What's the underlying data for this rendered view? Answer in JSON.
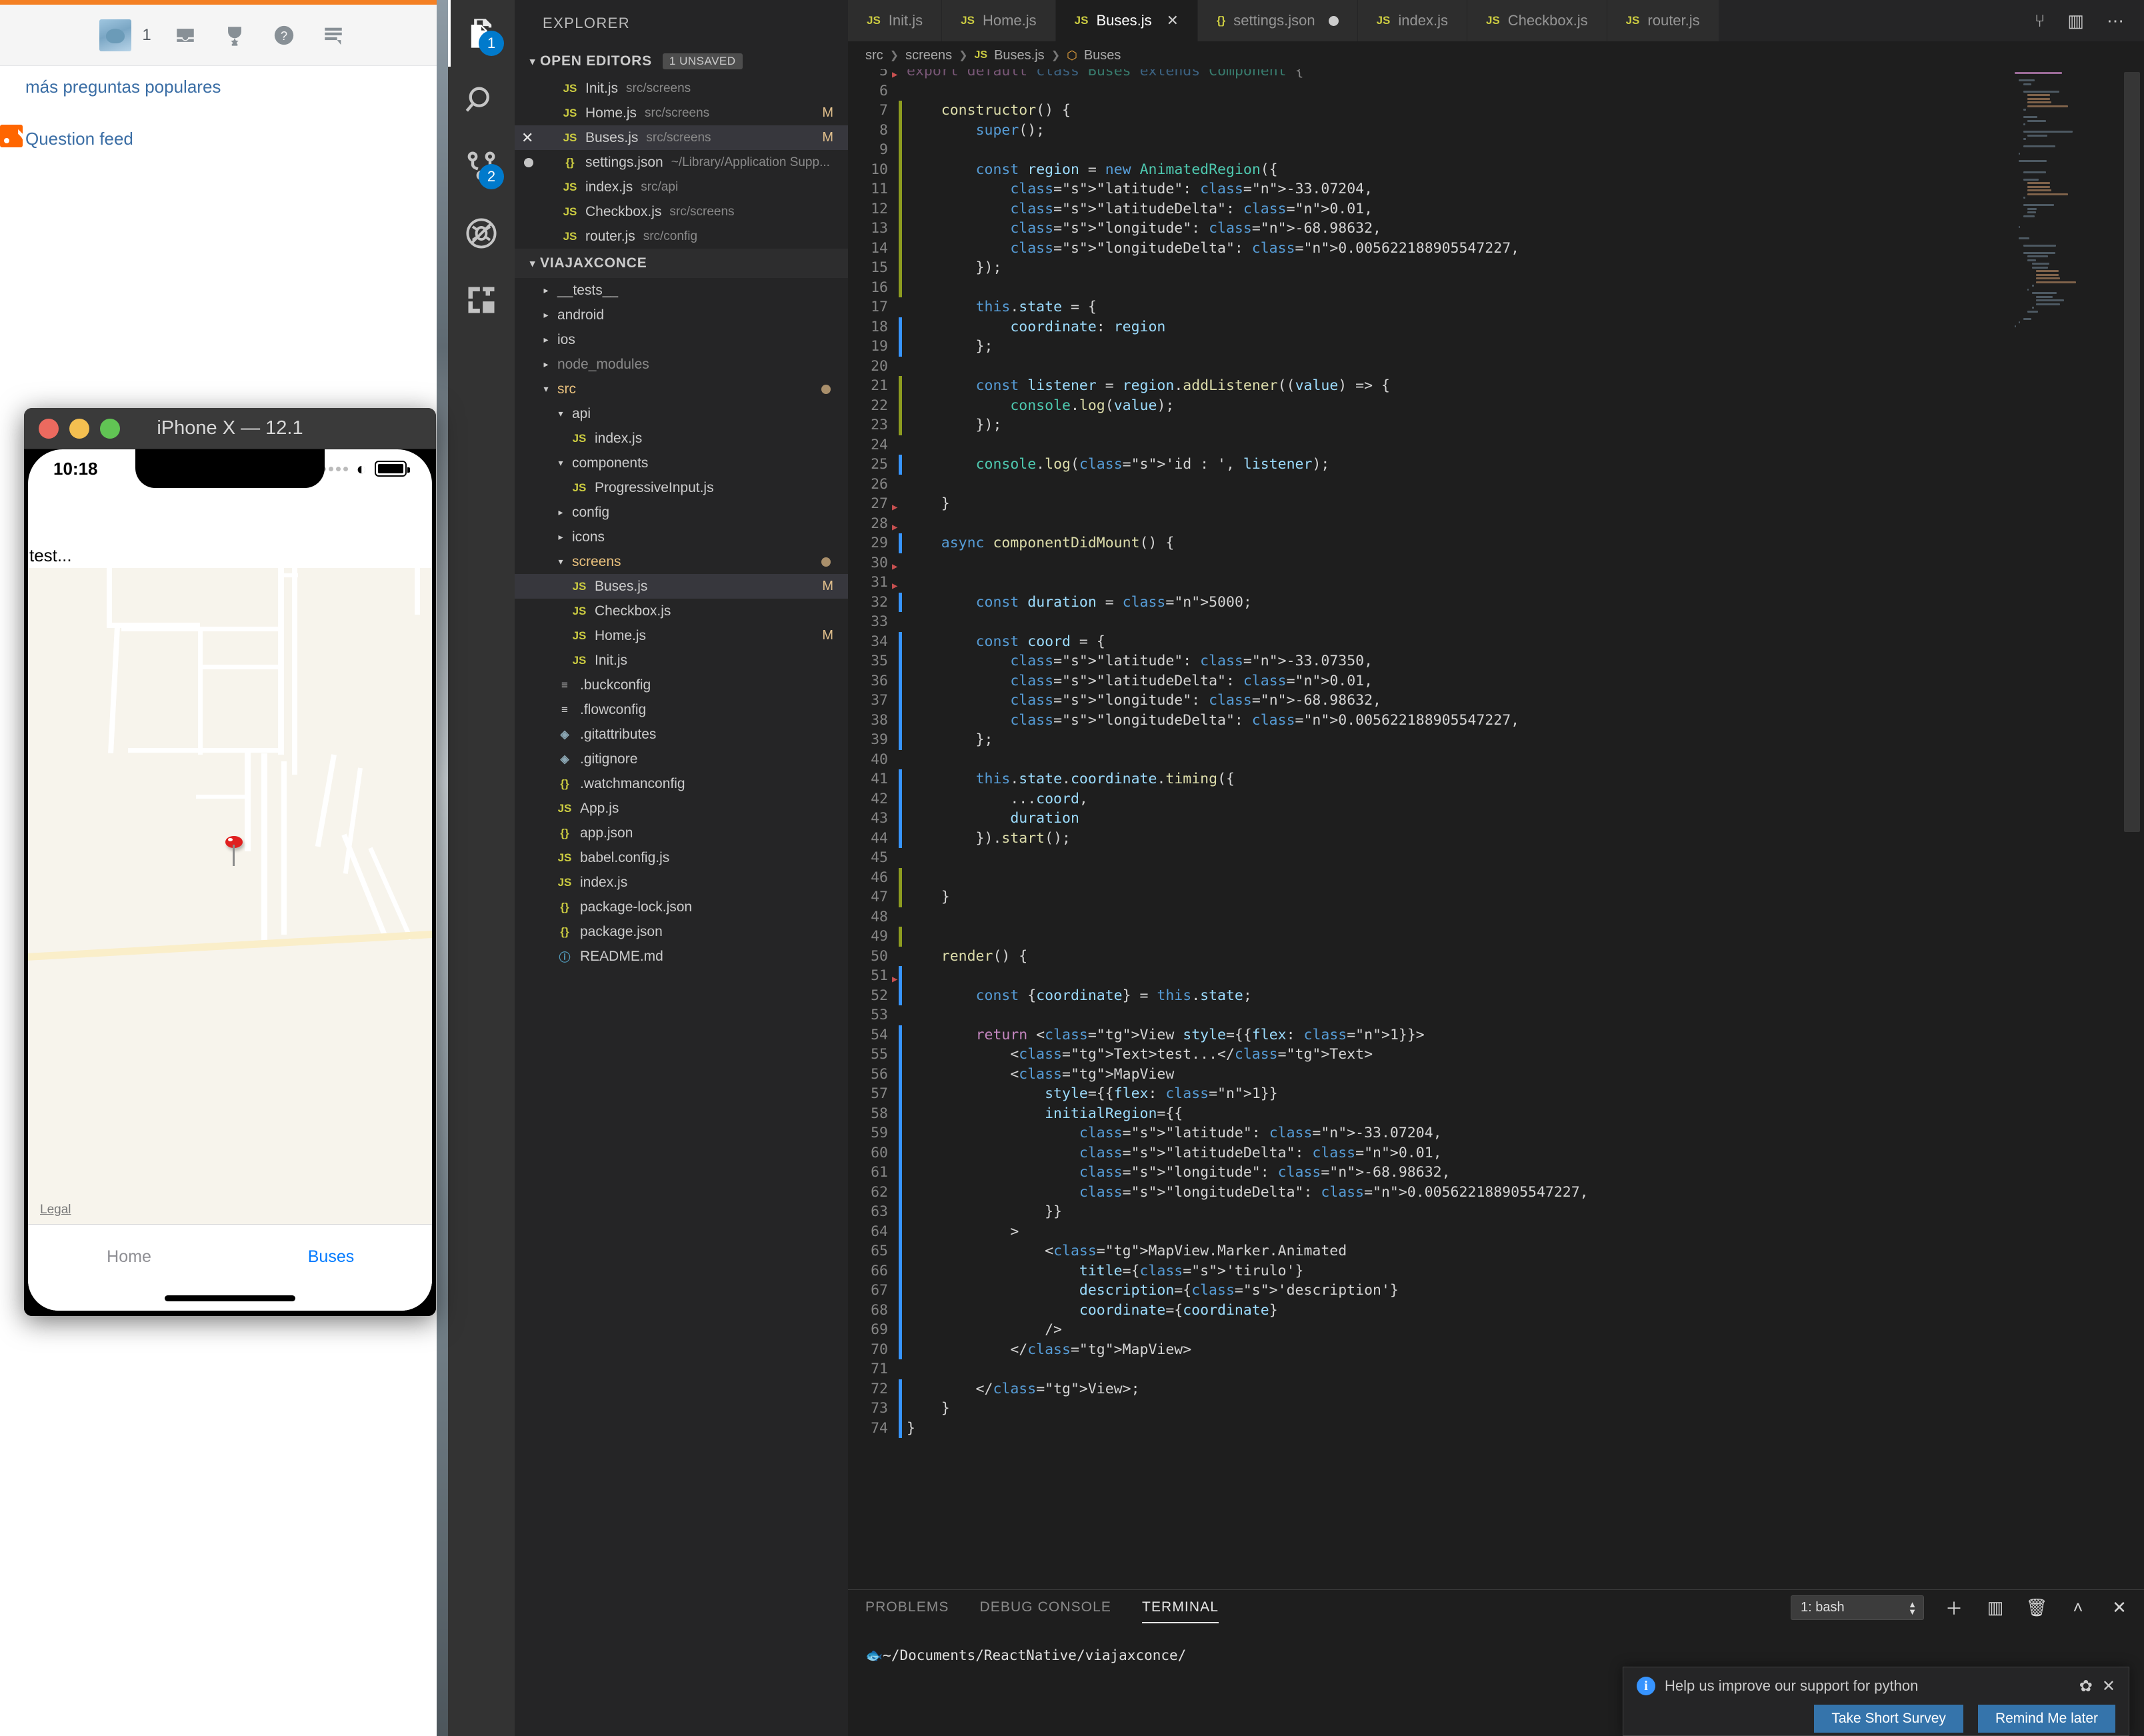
{
  "browser": {
    "notification_count": "1",
    "icons": [
      "inbox-icon",
      "trophy-icon",
      "help-icon",
      "reviews-icon"
    ],
    "links": [
      {
        "label": "más preguntas populares"
      },
      {
        "label": "Question feed"
      }
    ]
  },
  "activitybar": {
    "items": [
      {
        "name": "explorer",
        "icon": "files-icon",
        "badge": "1",
        "active": true
      },
      {
        "name": "search",
        "icon": "search-icon",
        "badge": ""
      },
      {
        "name": "source-control",
        "icon": "source-control-icon",
        "badge": "2"
      },
      {
        "name": "debug",
        "icon": "debug-no-icon",
        "badge": ""
      },
      {
        "name": "extensions",
        "icon": "extensions-icon",
        "badge": ""
      }
    ]
  },
  "sidebar": {
    "title": "EXPLORER",
    "open_editors": {
      "label": "OPEN EDITORS",
      "badge": "1 UNSAVED",
      "items": [
        {
          "icon": "js",
          "name": "Init.js",
          "path": "src/screens",
          "flag": "",
          "state": ""
        },
        {
          "icon": "js",
          "name": "Home.js",
          "path": "src/screens",
          "flag": "M",
          "state": ""
        },
        {
          "icon": "js",
          "name": "Buses.js",
          "path": "src/screens",
          "flag": "M",
          "state": "selected"
        },
        {
          "icon": "json",
          "name": "settings.json",
          "path": "~/Library/Application Supp...",
          "flag": "",
          "state": "dirty"
        },
        {
          "icon": "js",
          "name": "index.js",
          "path": "src/api",
          "flag": "",
          "state": ""
        },
        {
          "icon": "js",
          "name": "Checkbox.js",
          "path": "src/screens",
          "flag": "",
          "state": ""
        },
        {
          "icon": "js",
          "name": "router.js",
          "path": "src/config",
          "flag": "",
          "state": ""
        }
      ]
    },
    "project": {
      "label": "VIAJAXCONCE",
      "items": [
        {
          "kind": "folder",
          "caret": "collapsed",
          "name": "__tests__",
          "indent": 1,
          "dim": false
        },
        {
          "kind": "folder",
          "caret": "collapsed",
          "name": "android",
          "indent": 1,
          "dim": false
        },
        {
          "kind": "folder",
          "caret": "collapsed",
          "name": "ios",
          "indent": 1,
          "dim": false
        },
        {
          "kind": "folder",
          "caret": "collapsed",
          "name": "node_modules",
          "indent": 1,
          "dim": true
        },
        {
          "kind": "folder",
          "caret": "expanded",
          "name": "src",
          "indent": 1,
          "dim": false,
          "highlight": true,
          "dot": true
        },
        {
          "kind": "folder",
          "caret": "expanded",
          "name": "api",
          "indent": 2,
          "dim": false
        },
        {
          "kind": "file",
          "icon": "js",
          "name": "index.js",
          "indent": 3,
          "dim": false
        },
        {
          "kind": "folder",
          "caret": "expanded",
          "name": "components",
          "indent": 2,
          "dim": false
        },
        {
          "kind": "file",
          "icon": "js",
          "name": "ProgressiveInput.js",
          "indent": 3,
          "dim": false
        },
        {
          "kind": "folder",
          "caret": "collapsed",
          "name": "config",
          "indent": 2,
          "dim": false
        },
        {
          "kind": "folder",
          "caret": "collapsed",
          "name": "icons",
          "indent": 2,
          "dim": false
        },
        {
          "kind": "folder",
          "caret": "expanded",
          "name": "screens",
          "indent": 2,
          "dim": false,
          "highlight": true,
          "dot": true
        },
        {
          "kind": "file",
          "icon": "js",
          "name": "Buses.js",
          "indent": 3,
          "flag": "M",
          "state": "selected"
        },
        {
          "kind": "file",
          "icon": "js",
          "name": "Checkbox.js",
          "indent": 3
        },
        {
          "kind": "file",
          "icon": "js",
          "name": "Home.js",
          "indent": 3,
          "flag": "M"
        },
        {
          "kind": "file",
          "icon": "js",
          "name": "Init.js",
          "indent": 3
        },
        {
          "kind": "file",
          "icon": "cfg",
          "name": ".buckconfig",
          "indent": 2
        },
        {
          "kind": "file",
          "icon": "cfg",
          "name": ".flowconfig",
          "indent": 2
        },
        {
          "kind": "file",
          "icon": "git",
          "name": ".gitattributes",
          "indent": 2
        },
        {
          "kind": "file",
          "icon": "git",
          "name": ".gitignore",
          "indent": 2
        },
        {
          "kind": "file",
          "icon": "json",
          "name": ".watchmanconfig",
          "indent": 2
        },
        {
          "kind": "file",
          "icon": "js",
          "name": "App.js",
          "indent": 2
        },
        {
          "kind": "file",
          "icon": "json",
          "name": "app.json",
          "indent": 2
        },
        {
          "kind": "file",
          "icon": "js",
          "name": "babel.config.js",
          "indent": 2
        },
        {
          "kind": "file",
          "icon": "js",
          "name": "index.js",
          "indent": 2
        },
        {
          "kind": "file",
          "icon": "json",
          "name": "package-lock.json",
          "indent": 2
        },
        {
          "kind": "file",
          "icon": "json",
          "name": "package.json",
          "indent": 2
        },
        {
          "kind": "file",
          "icon": "md",
          "name": "README.md",
          "indent": 2
        }
      ]
    }
  },
  "editor": {
    "tabs": [
      {
        "icon": "js",
        "label": "Init.js",
        "active": false,
        "close": false,
        "dirty": false
      },
      {
        "icon": "js",
        "label": "Home.js",
        "active": false,
        "close": false,
        "dirty": false
      },
      {
        "icon": "js",
        "label": "Buses.js",
        "active": true,
        "close": true,
        "dirty": false
      },
      {
        "icon": "json",
        "label": "settings.json",
        "active": false,
        "close": false,
        "dirty": true
      },
      {
        "icon": "js",
        "label": "index.js",
        "active": false,
        "close": false,
        "dirty": false
      },
      {
        "icon": "js",
        "label": "Checkbox.js",
        "active": false,
        "close": false,
        "dirty": false
      },
      {
        "icon": "js",
        "label": "router.js",
        "active": false,
        "close": false,
        "dirty": false
      }
    ],
    "tab_actions": [
      "split-editor-icon",
      "layout-icon",
      "more-actions-icon"
    ],
    "breadcrumb": [
      "src",
      "screens",
      "Buses.js",
      "Buses"
    ],
    "first_line_number": 5,
    "lines": [
      {
        "n": 5,
        "text": "export default class Buses extends Component {",
        "gutter": "",
        "fold": true,
        "partial": true
      },
      {
        "n": 6,
        "text": ""
      },
      {
        "n": 7,
        "text": "    constructor() {",
        "gutter": "g"
      },
      {
        "n": 8,
        "text": "        super();",
        "gutter": "g"
      },
      {
        "n": 9,
        "text": "",
        "gutter": "g"
      },
      {
        "n": 10,
        "text": "        const region = new AnimatedRegion({",
        "gutter": "g"
      },
      {
        "n": 11,
        "text": "            \"latitude\": -33.07204,",
        "gutter": "g"
      },
      {
        "n": 12,
        "text": "            \"latitudeDelta\": 0.01,",
        "gutter": "g"
      },
      {
        "n": 13,
        "text": "            \"longitude\": -68.98632,",
        "gutter": "g"
      },
      {
        "n": 14,
        "text": "            \"longitudeDelta\": 0.005622188905547227,",
        "gutter": "g"
      },
      {
        "n": 15,
        "text": "        });",
        "gutter": "g"
      },
      {
        "n": 16,
        "text": "",
        "gutter": "g"
      },
      {
        "n": 17,
        "text": "        this.state = {",
        "gutter": ""
      },
      {
        "n": 18,
        "text": "            coordinate: region",
        "gutter": "b"
      },
      {
        "n": 19,
        "text": "        };",
        "gutter": "b"
      },
      {
        "n": 20,
        "text": ""
      },
      {
        "n": 21,
        "text": "        const listener = region.addListener((value) => {",
        "gutter": "g"
      },
      {
        "n": 22,
        "text": "            console.log(value);",
        "gutter": "g"
      },
      {
        "n": 23,
        "text": "        });",
        "gutter": "g"
      },
      {
        "n": 24,
        "text": ""
      },
      {
        "n": 25,
        "text": "        console.log('id : ', listener);",
        "gutter": "b"
      },
      {
        "n": 26,
        "text": ""
      },
      {
        "n": 27,
        "text": "    }",
        "gutter": "",
        "fold": true
      },
      {
        "n": 28,
        "text": "",
        "fold": true
      },
      {
        "n": 29,
        "text": "    async componentDidMount() {",
        "gutter": "b"
      },
      {
        "n": 30,
        "text": "",
        "fold": true
      },
      {
        "n": 31,
        "text": "",
        "fold": true
      },
      {
        "n": 32,
        "text": "        const duration = 5000;",
        "gutter": "b"
      },
      {
        "n": 33,
        "text": ""
      },
      {
        "n": 34,
        "text": "        const coord = {",
        "gutter": "b"
      },
      {
        "n": 35,
        "text": "            \"latitude\": -33.07350,",
        "gutter": "b"
      },
      {
        "n": 36,
        "text": "            \"latitudeDelta\": 0.01,",
        "gutter": "b"
      },
      {
        "n": 37,
        "text": "            \"longitude\": -68.98632,",
        "gutter": "b"
      },
      {
        "n": 38,
        "text": "            \"longitudeDelta\": 0.005622188905547227,",
        "gutter": "b"
      },
      {
        "n": 39,
        "text": "        };",
        "gutter": "b"
      },
      {
        "n": 40,
        "text": ""
      },
      {
        "n": 41,
        "text": "        this.state.coordinate.timing({",
        "gutter": "b"
      },
      {
        "n": 42,
        "text": "            ...coord,",
        "gutter": "b"
      },
      {
        "n": 43,
        "text": "            duration",
        "gutter": "b"
      },
      {
        "n": 44,
        "text": "        }).start();",
        "gutter": "b"
      },
      {
        "n": 45,
        "text": ""
      },
      {
        "n": 46,
        "text": "",
        "gutter": "g"
      },
      {
        "n": 47,
        "text": "    }",
        "gutter": "g"
      },
      {
        "n": 48,
        "text": ""
      },
      {
        "n": 49,
        "text": "",
        "gutter": "g"
      },
      {
        "n": 50,
        "text": "    render() {",
        "gutter": ""
      },
      {
        "n": 51,
        "text": "",
        "gutter": "b",
        "fold": true
      },
      {
        "n": 52,
        "text": "        const {coordinate} = this.state;",
        "gutter": "b"
      },
      {
        "n": 53,
        "text": ""
      },
      {
        "n": 54,
        "text": "        return <View style={{flex: 1}}>",
        "gutter": "b"
      },
      {
        "n": 55,
        "text": "            <Text>test...</Text>",
        "gutter": "b"
      },
      {
        "n": 56,
        "text": "            <MapView",
        "gutter": "b"
      },
      {
        "n": 57,
        "text": "                style={{flex: 1}}",
        "gutter": "b"
      },
      {
        "n": 58,
        "text": "                initialRegion={{",
        "gutter": "b"
      },
      {
        "n": 59,
        "text": "                    \"latitude\": -33.07204,",
        "gutter": "b"
      },
      {
        "n": 60,
        "text": "                    \"latitudeDelta\": 0.01,",
        "gutter": "b"
      },
      {
        "n": 61,
        "text": "                    \"longitude\": -68.98632,",
        "gutter": "b"
      },
      {
        "n": 62,
        "text": "                    \"longitudeDelta\": 0.005622188905547227,",
        "gutter": "b"
      },
      {
        "n": 63,
        "text": "                }}",
        "gutter": "b"
      },
      {
        "n": 64,
        "text": "            >",
        "gutter": "b"
      },
      {
        "n": 65,
        "text": "                <MapView.Marker.Animated",
        "gutter": "b"
      },
      {
        "n": 66,
        "text": "                    title={'tirulo'}",
        "gutter": "b"
      },
      {
        "n": 67,
        "text": "                    description={'description'}",
        "gutter": "b"
      },
      {
        "n": 68,
        "text": "                    coordinate={coordinate}",
        "gutter": "b"
      },
      {
        "n": 69,
        "text": "                />",
        "gutter": "b"
      },
      {
        "n": 70,
        "text": "            </MapView>",
        "gutter": "b"
      },
      {
        "n": 71,
        "text": ""
      },
      {
        "n": 72,
        "text": "        </View>;",
        "gutter": "b"
      },
      {
        "n": 73,
        "text": "    }",
        "gutter": "b"
      },
      {
        "n": 74,
        "text": "}",
        "gutter": "b"
      }
    ]
  },
  "panel": {
    "tabs": [
      {
        "label": "PROBLEMS",
        "active": false
      },
      {
        "label": "DEBUG CONSOLE",
        "active": false
      },
      {
        "label": "TERMINAL",
        "active": true
      }
    ],
    "terminal_select": "1: bash",
    "actions": [
      "new-terminal-icon",
      "split-terminal-icon",
      "kill-terminal-icon",
      "maximize-panel-icon",
      "close-panel-icon"
    ],
    "prompt": "~/Documents/ReactNative/viajaxconce/"
  },
  "notification": {
    "icon": "info-icon",
    "message": "Help us improve our support for python",
    "gear": "gear-icon",
    "close": "close-icon",
    "buttons": [
      "Take Short Survey",
      "Remind Me later"
    ]
  },
  "simulator": {
    "window_title": "iPhone X — 12.1",
    "status_time": "10:18",
    "app_text": "test...",
    "map_legal": "Legal",
    "tabs": [
      {
        "label": "Home",
        "active": false
      },
      {
        "label": "Buses",
        "active": true
      }
    ]
  },
  "colors": {
    "accent": "#007acc",
    "tab_active_bg": "#1e1e1e",
    "sidebar_bg": "#252526",
    "editor_bg": "#1e1e1e",
    "ios_blue": "#007aff",
    "pin_red": "#e02020",
    "so_orange": "#f48024"
  }
}
